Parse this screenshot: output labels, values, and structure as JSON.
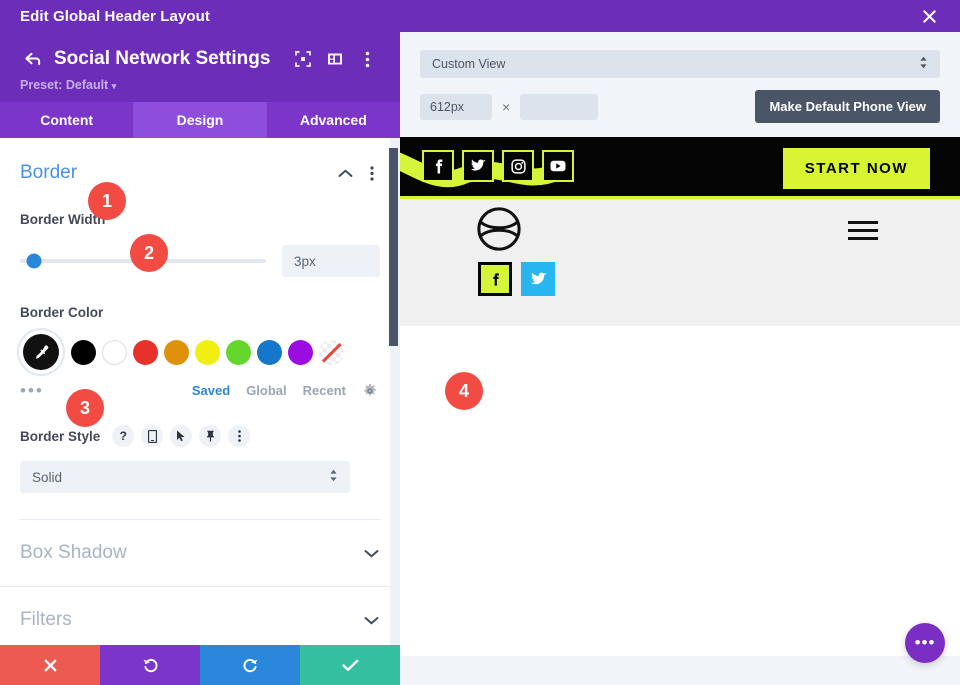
{
  "window": {
    "title": "Edit Global Header Layout",
    "close_icon": "close-icon"
  },
  "panel": {
    "title": "Social Network Settings",
    "back_icon": "back-arrow-icon",
    "header_icons": [
      "target-focus-icon",
      "layout-panel-icon",
      "kebab-menu-icon"
    ],
    "preset": "Preset: Default",
    "preset_caret": "▾",
    "tabs": [
      {
        "label": "Content",
        "active": false
      },
      {
        "label": "Design",
        "active": true
      },
      {
        "label": "Advanced",
        "active": false
      }
    ],
    "sections": {
      "border": {
        "title": "Border",
        "width_label": "Border Width",
        "width_value": "3px",
        "color_label": "Border Color",
        "swatches": [
          {
            "name": "eyedropper-selected",
            "color": "#111111"
          },
          {
            "name": "black",
            "color": "#000000"
          },
          {
            "name": "white",
            "color": "#ffffff"
          },
          {
            "name": "red",
            "color": "#e8312a"
          },
          {
            "name": "orange",
            "color": "#e0910b"
          },
          {
            "name": "yellow",
            "color": "#f0ef10"
          },
          {
            "name": "green",
            "color": "#64d62c"
          },
          {
            "name": "blue",
            "color": "#1577cc"
          },
          {
            "name": "purple",
            "color": "#9b0ce0"
          },
          {
            "name": "transparent",
            "color": "none"
          }
        ],
        "palette_tabs": [
          {
            "label": "Saved",
            "active": true
          },
          {
            "label": "Global",
            "active": false
          },
          {
            "label": "Recent",
            "active": false
          }
        ],
        "gear_icon": "gear-icon",
        "more_icon": "more-dots-icon",
        "style_label": "Border Style",
        "style_icons": [
          "help-icon",
          "phone-icon",
          "cursor-icon",
          "pin-icon",
          "kebab-menu-icon"
        ],
        "style_value": "Solid"
      },
      "box_shadow": {
        "title": "Box Shadow"
      },
      "filters": {
        "title": "Filters"
      }
    },
    "actions": [
      {
        "name": "cancel-button",
        "icon": "x-icon",
        "color": "#ed5a52"
      },
      {
        "name": "undo-button",
        "icon": "undo-icon",
        "color": "#7b35c9"
      },
      {
        "name": "redo-button",
        "icon": "redo-icon",
        "color": "#2b87da"
      },
      {
        "name": "save-button",
        "icon": "check-icon",
        "color": "#33bfa0"
      }
    ]
  },
  "preview": {
    "view_select": "Custom View",
    "width_value": "612px",
    "height_value": "",
    "multiply_symbol": "×",
    "default_phone_button": "Make Default Phone View",
    "header": {
      "socials": [
        "facebook-icon",
        "twitter-icon",
        "instagram-icon",
        "youtube-icon"
      ],
      "cta": "START NOW"
    },
    "module": {
      "logo": "circle-logo-icon",
      "menu": "hamburger-menu-icon",
      "socials": [
        "facebook-icon",
        "twitter-icon"
      ]
    },
    "fab": "more-dots-icon"
  },
  "badges": [
    {
      "number": "1"
    },
    {
      "number": "2"
    },
    {
      "number": "3"
    },
    {
      "number": "4"
    }
  ]
}
